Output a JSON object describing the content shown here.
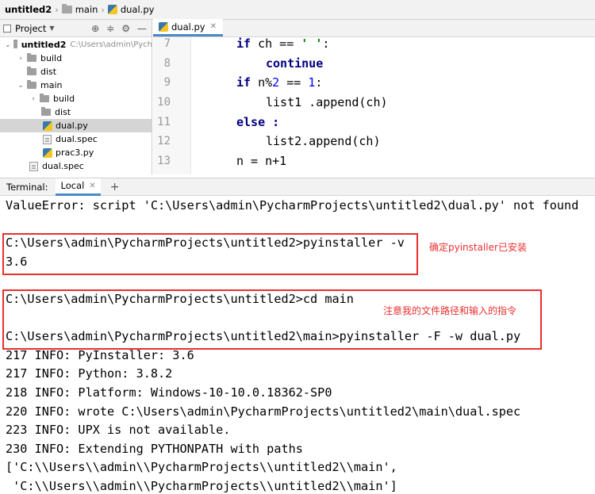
{
  "breadcrumb": {
    "items": [
      "untitled2",
      "main",
      "dual.py"
    ]
  },
  "project_panel": {
    "title": "Project",
    "tree": [
      {
        "label": "untitled2",
        "hint": "C:\\Users\\admin\\Pych",
        "kind": "folder",
        "expanded": true
      },
      {
        "label": "build",
        "kind": "folder",
        "expanded": false
      },
      {
        "label": "dist",
        "kind": "folder"
      },
      {
        "label": "main",
        "kind": "folder",
        "expanded": true
      },
      {
        "label": "build",
        "kind": "folder",
        "expanded": false
      },
      {
        "label": "dist",
        "kind": "folder"
      },
      {
        "label": "dual.py",
        "kind": "python",
        "selected": true
      },
      {
        "label": "dual.spec",
        "kind": "spec"
      },
      {
        "label": "prac3.py",
        "kind": "python"
      },
      {
        "label": "dual.spec",
        "kind": "spec"
      }
    ]
  },
  "editor": {
    "tab_label": "dual.py",
    "lines": [
      {
        "num": "7",
        "text": "if ch == ' ':"
      },
      {
        "num": "8",
        "text": "continue"
      },
      {
        "num": "9",
        "text": "if n%2 == 1:"
      },
      {
        "num": "10",
        "text": "list1 .append(ch)"
      },
      {
        "num": "11",
        "text": "else :"
      },
      {
        "num": "12",
        "text": "list2.append(ch)"
      },
      {
        "num": "13",
        "text": "n = n+1"
      }
    ]
  },
  "terminal": {
    "label": "Terminal:",
    "tab_label": "Local",
    "add_label": "+",
    "lines": [
      "ValueError: script 'C:\\Users\\admin\\PycharmProjects\\untitled2\\dual.py' not found",
      "",
      "C:\\Users\\admin\\PycharmProjects\\untitled2>pyinstaller -v",
      "3.6",
      "",
      "C:\\Users\\admin\\PycharmProjects\\untitled2>cd main",
      "",
      "C:\\Users\\admin\\PycharmProjects\\untitled2\\main>pyinstaller -F -w dual.py",
      "217 INFO: PyInstaller: 3.6",
      "217 INFO: Python: 3.8.2",
      "218 INFO: Platform: Windows-10-10.0.18362-SP0",
      "220 INFO: wrote C:\\Users\\admin\\PycharmProjects\\untitled2\\main\\dual.spec",
      "223 INFO: UPX is not available.",
      "230 INFO: Extending PYTHONPATH with paths",
      "['C:\\\\Users\\\\admin\\\\PycharmProjects\\\\untitled2\\\\main',",
      " 'C:\\\\Users\\\\admin\\\\PycharmProjects\\\\untitled2\\\\main']"
    ]
  },
  "annotations": {
    "note1": "确定pyinstaller已安装",
    "note2": "注意我的文件路径和输入的指令",
    "color": "#e8302f"
  }
}
